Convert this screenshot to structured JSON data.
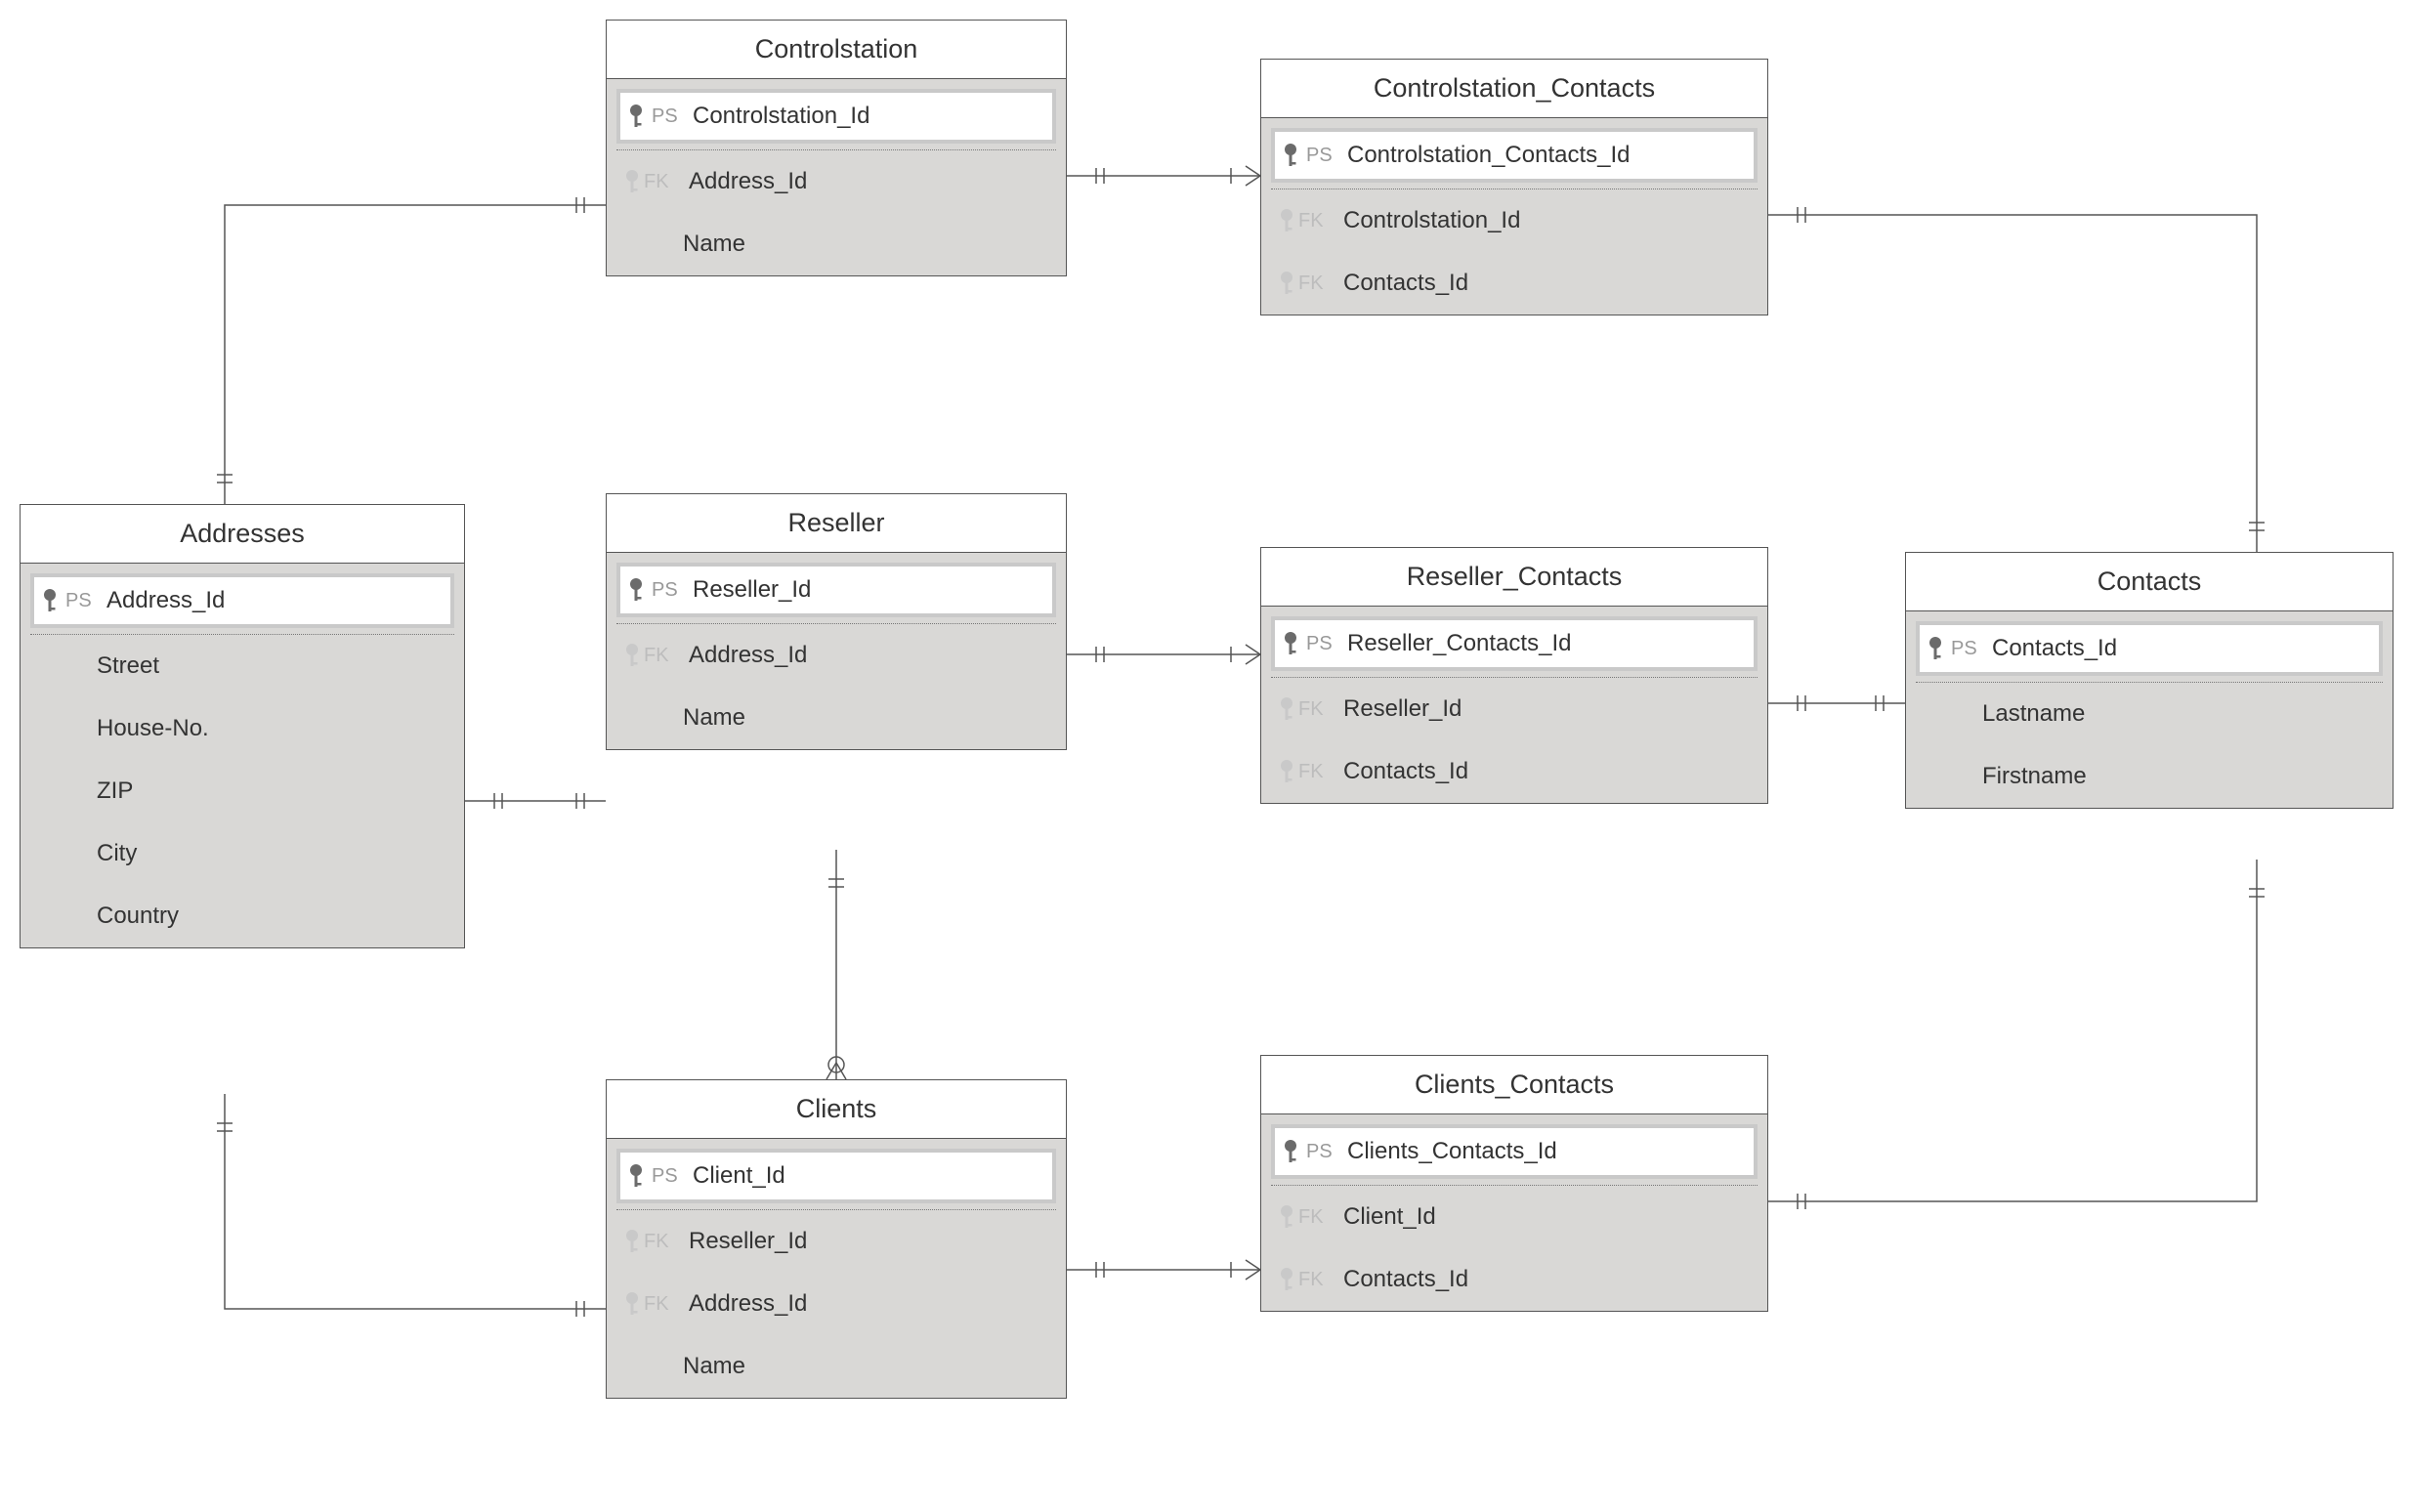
{
  "entities": {
    "addresses": {
      "title": "Addresses",
      "pk": "Address_Id",
      "fields": [
        "Street",
        "House-No.",
        "ZIP",
        "City",
        "Country"
      ]
    },
    "controlstation": {
      "title": "Controlstation",
      "pk": "Controlstation_Id",
      "fk": [
        {
          "label": "FK",
          "name": "Address_Id"
        }
      ],
      "fields": [
        "Name"
      ]
    },
    "controlstation_contacts": {
      "title": "Controlstation_Contacts",
      "pk": "Controlstation_Contacts_Id",
      "fk": [
        {
          "label": "FK",
          "name": "Controlstation_Id"
        },
        {
          "label": "FK",
          "name": "Contacts_Id"
        }
      ]
    },
    "reseller": {
      "title": "Reseller",
      "pk": "Reseller_Id",
      "fk": [
        {
          "label": "FK",
          "name": "Address_Id"
        }
      ],
      "fields": [
        "Name"
      ]
    },
    "reseller_contacts": {
      "title": "Reseller_Contacts",
      "pk": "Reseller_Contacts_Id",
      "fk": [
        {
          "label": "FK",
          "name": "Reseller_Id"
        },
        {
          "label": "FK",
          "name": "Contacts_Id"
        }
      ]
    },
    "contacts": {
      "title": "Contacts",
      "pk": "Contacts_Id",
      "fields": [
        "Lastname",
        "Firstname"
      ]
    },
    "clients": {
      "title": "Clients",
      "pk": "Client_Id",
      "fk": [
        {
          "label": "FK",
          "name": "Reseller_Id"
        },
        {
          "label": "FK",
          "name": "Address_Id"
        }
      ],
      "fields": [
        "Name"
      ]
    },
    "clients_contacts": {
      "title": "Clients_Contacts",
      "pk": "Clients_Contacts_Id",
      "fk": [
        {
          "label": "FK",
          "name": "Client_Id"
        },
        {
          "label": "FK",
          "name": "Contacts_Id"
        }
      ]
    }
  },
  "labels": {
    "ps": "PS",
    "fk": "FK"
  }
}
